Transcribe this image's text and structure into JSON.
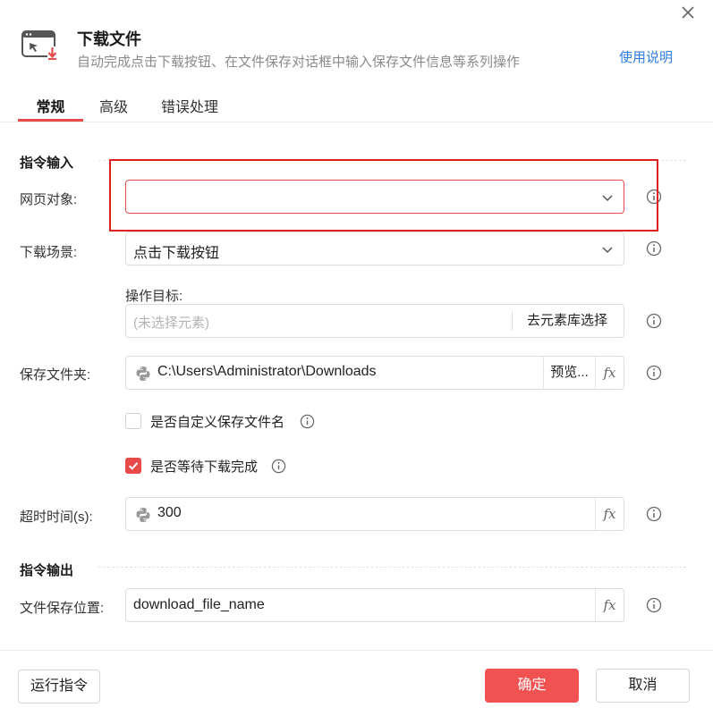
{
  "header": {
    "title": "下载文件",
    "subtitle": "自动完成点击下载按钮、在文件保存对话框中输入保存文件信息等系列操作",
    "help_link": "使用说明"
  },
  "tabs": [
    {
      "label": "常规",
      "active": true
    },
    {
      "label": "高级",
      "active": false
    },
    {
      "label": "错误处理",
      "active": false
    }
  ],
  "sections": {
    "input_title": "指令输入",
    "output_title": "指令输出"
  },
  "fields": {
    "web_object": {
      "label": "网页对象:",
      "value": ""
    },
    "download_scene": {
      "label": "下载场景:",
      "value": "点击下载按钮"
    },
    "target": {
      "label": "操作目标:",
      "placeholder": "(未选择元素)",
      "pick_label": "去元素库选择"
    },
    "save_folder": {
      "label": "保存文件夹:",
      "value": "C:\\Users\\Administrator\\Downloads",
      "browse_label": "预览..."
    },
    "custom_name": {
      "label": "是否自定义保存文件名",
      "checked": false
    },
    "wait_complete": {
      "label": "是否等待下载完成",
      "checked": true
    },
    "timeout": {
      "label": "超时时间(s):",
      "value": "300"
    },
    "save_position": {
      "label": "文件保存位置:",
      "value": "download_file_name"
    }
  },
  "fx_label": "fx",
  "buttons": {
    "run": "运行指令",
    "ok": "确定",
    "cancel": "取消"
  },
  "colors": {
    "accent": "#f05252",
    "link": "#2f7de1",
    "error_border": "#e34a4a",
    "highlight_box": "#e02020"
  }
}
